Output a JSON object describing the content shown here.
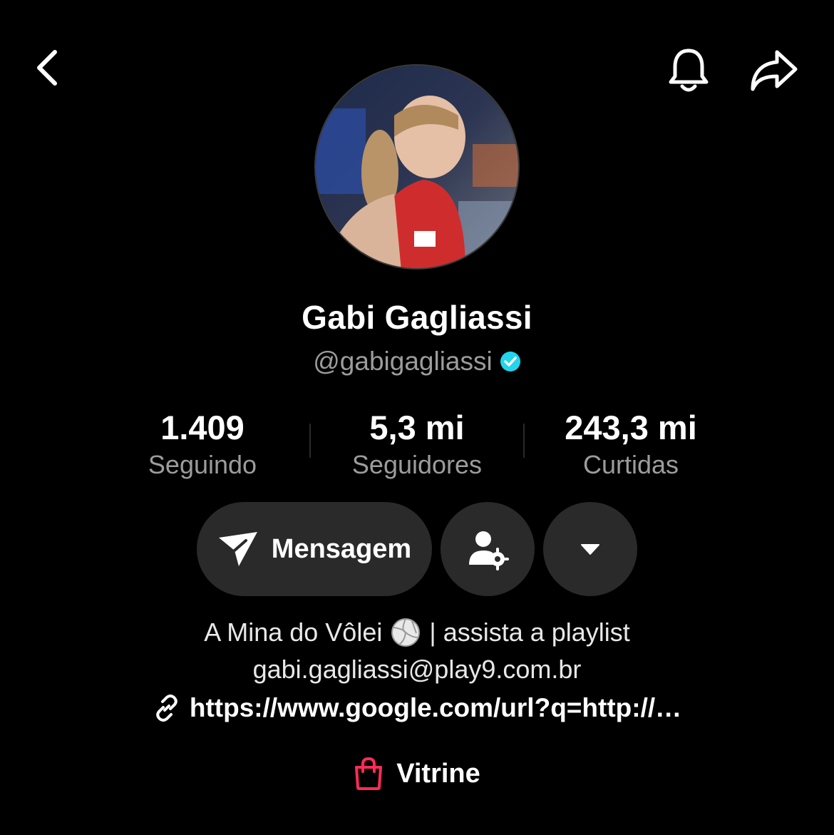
{
  "header": {
    "back_icon": "chevron-left-icon",
    "bell_icon": "bell-icon",
    "share_icon": "share-arrow-icon"
  },
  "profile": {
    "name": "Gabi Gagliassi",
    "handle": "@gabigagliassi",
    "verified": true
  },
  "stats": [
    {
      "value": "1.409",
      "label": "Seguindo"
    },
    {
      "value": "5,3 mi",
      "label": "Seguidores"
    },
    {
      "value": "243,3 mi",
      "label": "Curtidas"
    }
  ],
  "actions": {
    "message_label": "Mensagem",
    "message_icon": "send-icon",
    "user_settings_icon": "user-gear-icon",
    "dropdown_icon": "caret-down-icon"
  },
  "bio": {
    "line1_pre": "A Mina do Vôlei",
    "line1_post": "| assista a playlist",
    "line2": "gabi.gagliassi@play9.com.br",
    "link": "https://www.google.com/url?q=http://…",
    "showcase": "Vitrine"
  },
  "colors": {
    "background": "#000000",
    "button": "#2a2a2a",
    "secondary_text": "#9c9c9c",
    "verified": "#20d5ec",
    "showcase_icon": "#fe2c55"
  }
}
